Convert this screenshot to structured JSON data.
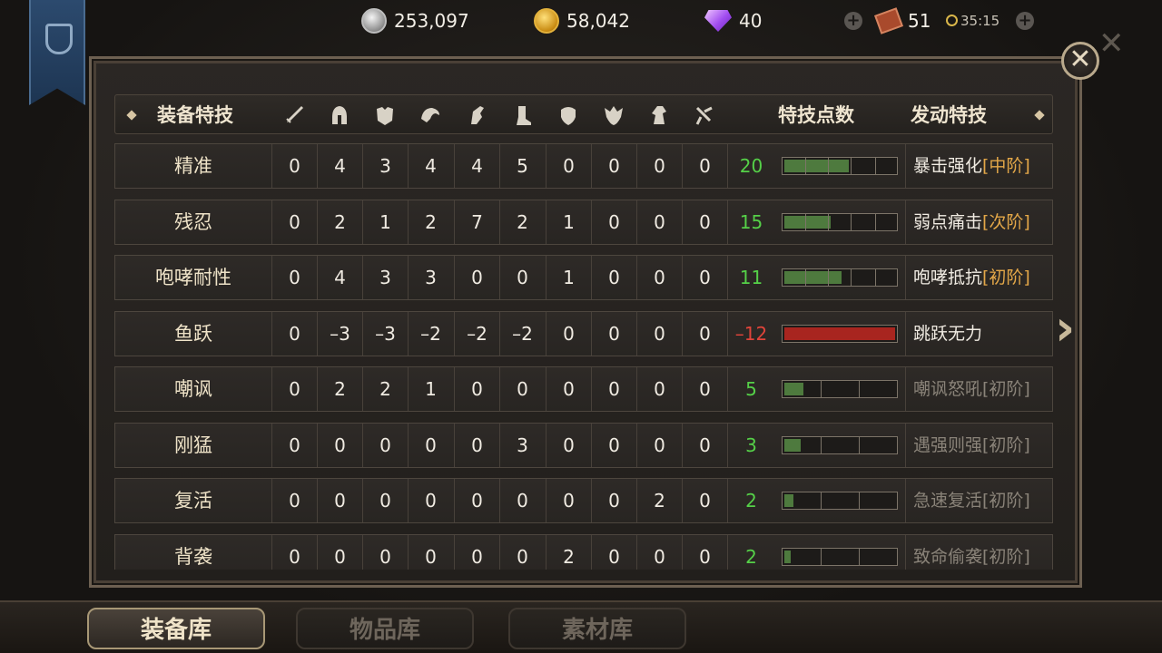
{
  "currency": {
    "silver": "253,097",
    "gold": "58,042",
    "gems": "40",
    "tickets": "51",
    "timer": "35:15"
  },
  "header": {
    "name_col": "装备特技",
    "points_col": "特技点数",
    "skill_col": "发动特技",
    "slot_icons": [
      "sword-icon",
      "helmet-icon",
      "chest-armor-icon",
      "pauldron-icon",
      "gauntlet-icon",
      "boots-icon",
      "shield-icon",
      "emblem-icon",
      "horse-icon",
      "accessory-icon"
    ]
  },
  "rows": [
    {
      "name": "精准",
      "vals": [
        "0",
        "4",
        "3",
        "4",
        "4",
        "5",
        "0",
        "0",
        "0",
        "0"
      ],
      "points": "20",
      "level": 0.58,
      "skill": "暴击强化",
      "tier": "[中阶]",
      "active": true,
      "neg": false
    },
    {
      "name": "残忍",
      "vals": [
        "0",
        "2",
        "1",
        "2",
        "7",
        "2",
        "1",
        "0",
        "0",
        "0"
      ],
      "points": "15",
      "level": 0.42,
      "skill": "弱点痛击",
      "tier": "[次阶]",
      "active": true,
      "neg": false
    },
    {
      "name": "咆哮耐性",
      "vals": [
        "0",
        "4",
        "3",
        "3",
        "0",
        "0",
        "1",
        "0",
        "0",
        "0"
      ],
      "points": "11",
      "level": 0.52,
      "skill": "咆哮抵抗",
      "tier": "[初阶]",
      "active": true,
      "neg": false
    },
    {
      "name": "鱼跃",
      "vals": [
        "0",
        "–3",
        "–3",
        "–2",
        "–2",
        "–2",
        "0",
        "0",
        "0",
        "0"
      ],
      "points": "–12",
      "level": 1.0,
      "skill": "跳跃无力",
      "tier": "",
      "active": true,
      "neg": true
    },
    {
      "name": "嘲讽",
      "vals": [
        "0",
        "2",
        "2",
        "1",
        "0",
        "0",
        "0",
        "0",
        "0",
        "0"
      ],
      "points": "5",
      "level": 0.17,
      "skill": "嘲讽怒吼",
      "tier": "[初阶]",
      "active": false,
      "neg": false
    },
    {
      "name": "刚猛",
      "vals": [
        "0",
        "0",
        "0",
        "0",
        "0",
        "3",
        "0",
        "0",
        "0",
        "0"
      ],
      "points": "3",
      "level": 0.15,
      "skill": "遇强则强",
      "tier": "[初阶]",
      "active": false,
      "neg": false
    },
    {
      "name": "复活",
      "vals": [
        "0",
        "0",
        "0",
        "0",
        "0",
        "0",
        "0",
        "0",
        "2",
        "0"
      ],
      "points": "2",
      "level": 0.08,
      "skill": "急速复活",
      "tier": "[初阶]",
      "active": false,
      "neg": false
    },
    {
      "name": "背袭",
      "vals": [
        "0",
        "0",
        "0",
        "0",
        "0",
        "0",
        "2",
        "0",
        "0",
        "0"
      ],
      "points": "2",
      "level": 0.06,
      "skill": "致命偷袭",
      "tier": "[初阶]",
      "active": false,
      "neg": false
    }
  ],
  "tabs": {
    "equipment": "装备库",
    "items": "物品库",
    "materials": "素材库"
  },
  "colors": {
    "positive_points": "#55d048",
    "negative_points": "#e0443a",
    "tier_accent": "#e3a748"
  }
}
